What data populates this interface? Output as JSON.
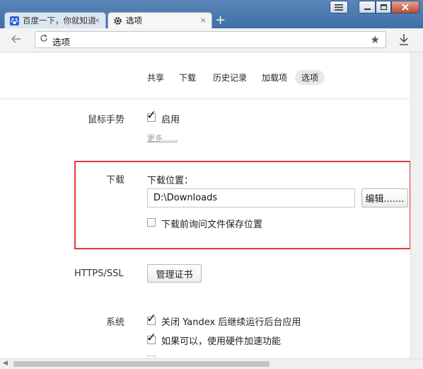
{
  "tabs": [
    {
      "title": "百度一下，你就知道",
      "icon": "baidu-paw-icon",
      "close": "×"
    },
    {
      "title": "选项",
      "icon": "gear-icon",
      "close": "×"
    }
  ],
  "new_tab": "+",
  "address_bar": {
    "text": "选项"
  },
  "section_nav": [
    "共享",
    "下载",
    "历史记录",
    "加载项",
    "选项"
  ],
  "selected_section": "选项",
  "mouse_gestures": {
    "label": "鼠标手势",
    "checkbox_label": "启用",
    "checked": true,
    "more_link": "更多......"
  },
  "downloads": {
    "label": "下载",
    "location_label": "下载位置：",
    "path": "D:\\Downloads",
    "edit_button": "编辑.......",
    "ask_label": "下载前询问文件保存位置",
    "ask_checked": false
  },
  "https": {
    "label": "HTTPS/SSL",
    "button": "管理证书"
  },
  "system": {
    "label": "系统",
    "option1": "关闭 Yandex 后继续运行后台应用",
    "option2": "如果可以，使用硬件加速功能"
  },
  "colors": {
    "highlight": "#e23b3b",
    "titlebar": "#3f6fa6"
  }
}
